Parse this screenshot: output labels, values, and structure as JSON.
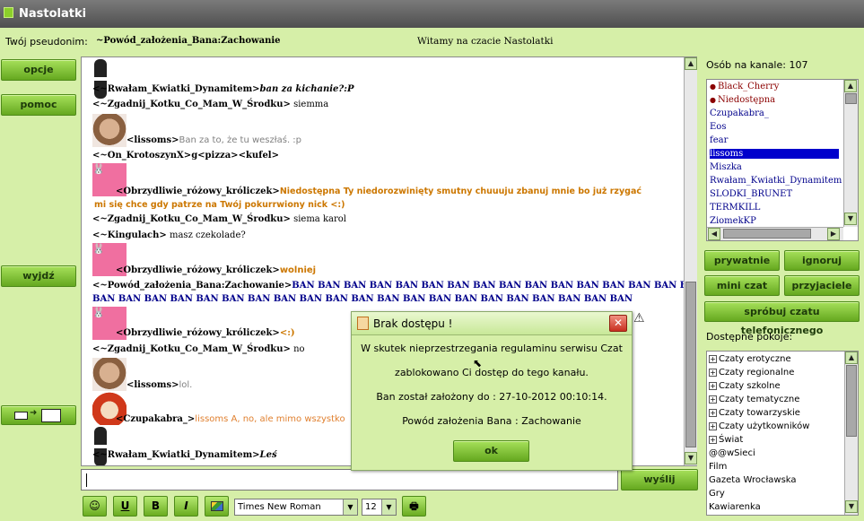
{
  "window": {
    "title": "Nastolatki"
  },
  "header": {
    "nick_label": "Twój pseudonim:",
    "nick_value": "~Powód_założenia_Bana:Zachowanie",
    "welcome": "Witamy na czacie Nastolatki"
  },
  "left_buttons": {
    "opcje": "opcje",
    "pomoc": "pomoc",
    "wyjdz": "wyjdź"
  },
  "messages": [
    {
      "nick": "<~Rwałam_Kwiatki_Dynamitem>",
      "text": "ban za kichanie?:P",
      "style": "italic"
    },
    {
      "nick": "<~Zgadnij_Kotku_Co_Mam_W_Środku>",
      "text": " siemma"
    },
    {
      "nick": "<lissoms>",
      "text": "Ban za to, że tu weszłaś. :p"
    },
    {
      "nick": "<~On_KrotoszynX>",
      "text": "g<pizza><kufel>"
    },
    {
      "nick": "<Obrzydliwie_różowy_króliczek>",
      "text": "Niedostępna Ty niedorozwinięty smutny chuuuju zbanuj mnie bo już rzygać"
    },
    {
      "nick": "",
      "text": "mi się chce gdy patrze na Twój pokurrwiony nick <:)"
    },
    {
      "nick": "<~Zgadnij_Kotku_Co_Mam_W_Środku>",
      "text": " siema karol"
    },
    {
      "nick": "<~Kingulach>",
      "text": " masz czekolade?"
    },
    {
      "nick": "<Obrzydliwie_różowy_króliczek>",
      "text": "wolniej"
    },
    {
      "nick": "<~Powód_założenia_Bana:Zachowanie>",
      "text": "BAN BAN BAN BAN BAN BAN BAN BAN BAN BAN BAN BAN BAN BAN BAN BAN BAN"
    },
    {
      "nick": "",
      "text": "BAN BAN BAN BAN BAN BAN BAN BAN BAN BAN BAN BAN BAN BAN BAN BAN BAN BAN BAN BAN BAN"
    },
    {
      "nick": "<Obrzydliwie_różowy_króliczek>",
      "text": "<:)"
    },
    {
      "nick": "<~Zgadnij_Kotku_Co_Mam_W_Środku>",
      "text": " no"
    },
    {
      "nick": "<lissoms>",
      "text": "lol."
    },
    {
      "nick": "<Czupakabra_>",
      "text": "lissoms A, no, ale mimo wszystko"
    },
    {
      "nick": "<~Rwałam_Kwiatki_Dynamitem>",
      "text": "Leś",
      "style": "italic"
    }
  ],
  "colors": {
    "pink": "#cc7700",
    "ban_blue": "#00008b",
    "lissoms_gray": "#808080",
    "czupakabra_orange": "#e08030"
  },
  "users_panel": {
    "label": "Osób na kanale: 107",
    "users": [
      "Black_Cherry",
      "Niedostępna",
      "Czupakabra_",
      "Eos",
      "fear",
      "lissoms",
      "Miszka",
      "Rwałam_Kwiatki_Dynamitem",
      "SLODKI_BRUNET",
      "TERMKILL",
      "ZiomekKP"
    ],
    "selected": "lissoms"
  },
  "action_buttons": {
    "prywatnie": "prywatnie",
    "ignoruj": "ignoruj",
    "mini_czat": "mini czat",
    "przyjaciele": "przyjaciele",
    "telefon": "spróbuj czatu telefonicznego"
  },
  "rooms_panel": {
    "label": "Dostępne pokoje:",
    "groups": [
      "Czaty erotyczne",
      "Czaty regionalne",
      "Czaty szkolne",
      "Czaty tematyczne",
      "Czaty towarzyskie",
      "Czaty użytkowników",
      "Świat"
    ],
    "rooms": [
      "@@wSieci",
      "Film",
      "Gazeta Wrocławska",
      "Gry",
      "Kawiarenka"
    ]
  },
  "input": {
    "value": "",
    "send_label": "wyślij"
  },
  "toolbar": {
    "underline": "U",
    "bold": "B",
    "italic": "I",
    "font": "Times New Roman",
    "size": "12"
  },
  "dialog": {
    "title": "Brak dostępu !",
    "line1": "W skutek nieprzestrzegania regulaminu serwisu Czat",
    "line2": "zablokowano Ci dostęp do tego kanału.",
    "line3": "Ban został założony do : 27-10-2012 00:10:14.",
    "line4": "Powód założenia Bana : Zachowanie",
    "ok_label": "ok",
    "close_glyph": "✕"
  }
}
